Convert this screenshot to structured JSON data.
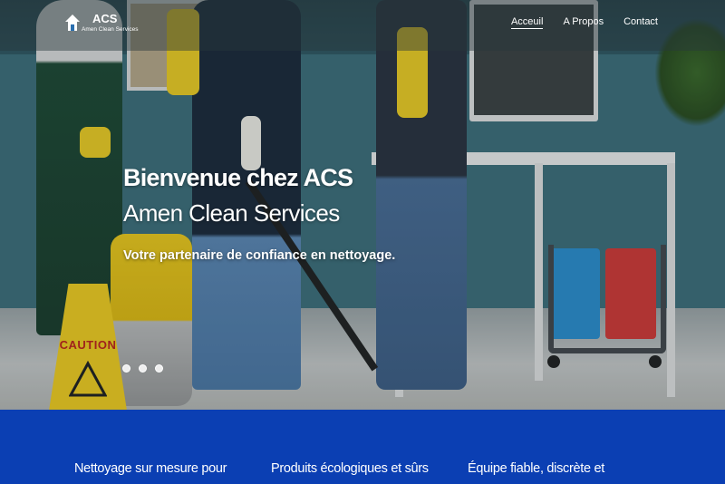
{
  "brand": {
    "logo_title": "ACS",
    "logo_subtitle": "Amen Clean Services"
  },
  "nav": {
    "items": [
      {
        "label": "Acceuil",
        "active": true
      },
      {
        "label": "A Propos",
        "active": false
      },
      {
        "label": "Contact",
        "active": false
      }
    ]
  },
  "hero": {
    "title": "Bienvenue chez ACS",
    "subtitle": "Amen Clean Services",
    "tagline": "Votre partenaire de confiance en nettoyage.",
    "sign_text": "CAUTION",
    "slides": 3,
    "active_slide": 1
  },
  "features": {
    "items": [
      {
        "label": "Nettoyage sur mesure pour"
      },
      {
        "label": "Produits écologiques et sûrs"
      },
      {
        "label": "Équipe fiable, discrète et"
      }
    ]
  },
  "colors": {
    "features_background": "#0b3fb3",
    "caution_yellow": "#f3cf20"
  }
}
